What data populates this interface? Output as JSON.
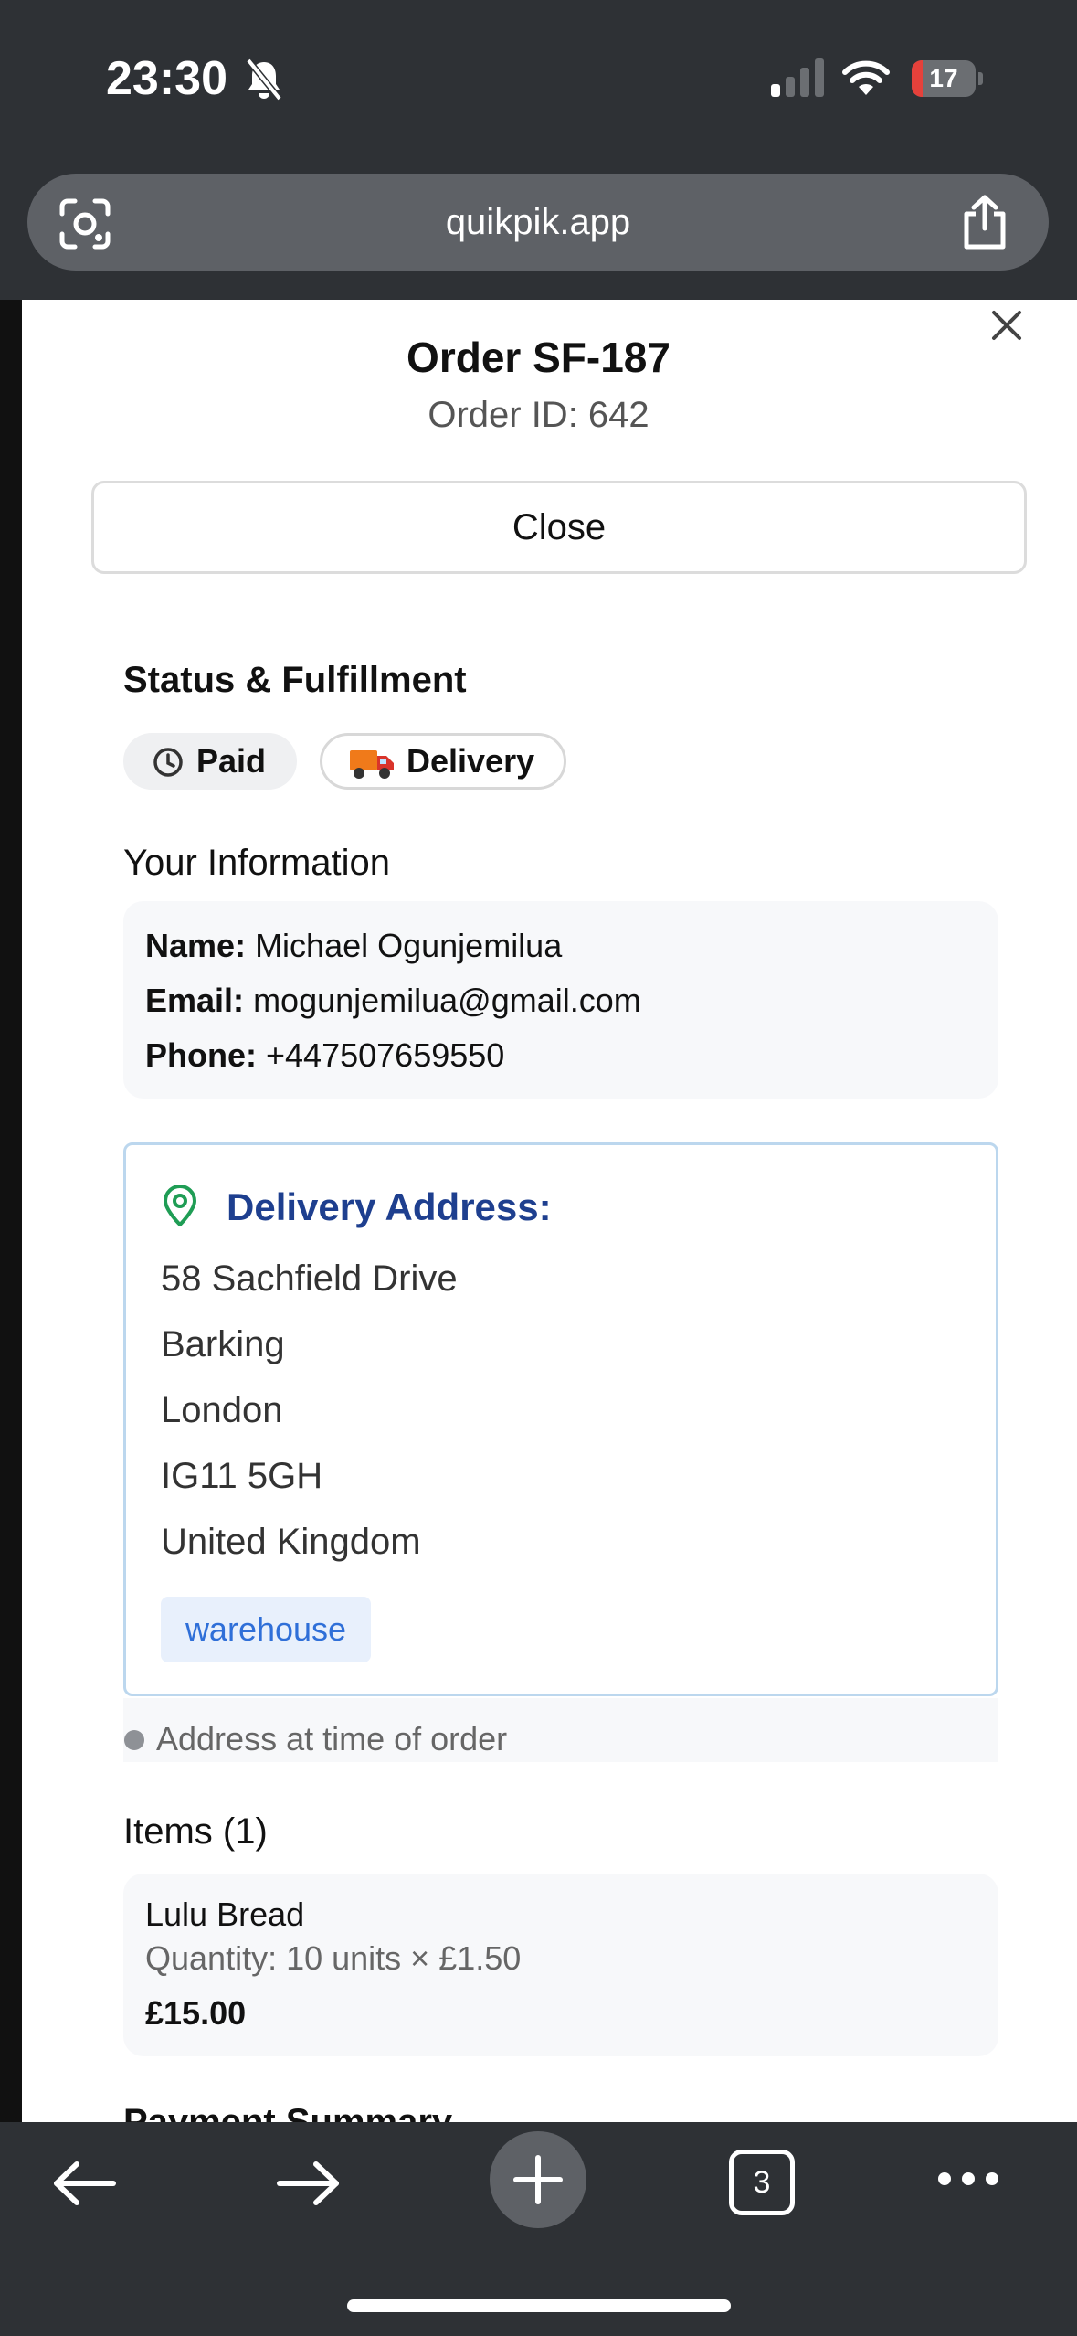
{
  "status_bar": {
    "time": "23:30",
    "battery": "17",
    "battery_level": 0.17,
    "battery_low_color": "#e5413b"
  },
  "browser": {
    "url": "quikpik.app",
    "tab_count": "3"
  },
  "order": {
    "title": "Order SF-187",
    "id_line": "Order ID: 642",
    "close_label": "Close"
  },
  "status": {
    "heading": "Status & Fulfillment",
    "payment": "Paid",
    "fulfillment": "Delivery",
    "fulfillment_emoji": "🚚"
  },
  "customer": {
    "heading": "Your Information",
    "name_label": "Name:",
    "name": "Michael Ogunjemilua",
    "email_label": "Email:",
    "email": "mogunjemilua@gmail.com",
    "phone_label": "Phone:",
    "phone": "+447507659550"
  },
  "delivery": {
    "heading": "Delivery Address:",
    "lines": [
      "58 Sachfield Drive",
      "Barking",
      "London",
      "IG11 5GH",
      "United Kingdom"
    ],
    "tag": "warehouse",
    "note": "Address at time of order",
    "accent": "#1e3f8f",
    "pin_color": "#1f9d55"
  },
  "items": {
    "heading": "Items (1)",
    "list": [
      {
        "name": "Lulu Bread",
        "quantity": "Quantity: 10 units × £1.50",
        "total": "£15.00"
      }
    ]
  },
  "next_section_heading": "Payment Summary",
  "icons": {
    "bell": "bell-slash-icon",
    "signal": "cellular-signal-icon",
    "wifi": "wifi-icon",
    "lens": "lens-icon",
    "share": "share-icon",
    "close": "close-icon",
    "clock": "clock-icon",
    "pin": "map-pin-icon",
    "back": "arrow-left-icon",
    "forward": "arrow-right-icon",
    "new_tab": "plus-icon",
    "more": "more-icon"
  }
}
